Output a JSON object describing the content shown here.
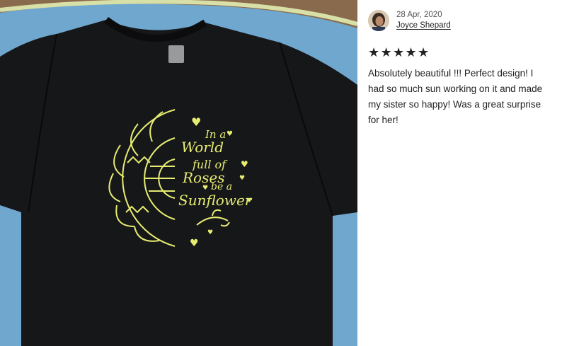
{
  "photo": {
    "print_text": [
      "In a",
      "World",
      "full of",
      "Roses",
      "be a",
      "Sunflower"
    ],
    "colors": {
      "shirt": "#161719",
      "print": "#e6ec70",
      "towel": "#6fa7cf",
      "floor": "#8a6a4c"
    }
  },
  "review": {
    "date": "28 Apr, 2020",
    "reviewer_name": "Joyce Shepard",
    "rating": 5,
    "stars": [
      "★",
      "★",
      "★",
      "★",
      "★"
    ],
    "text": "Absolutely beautiful !!! Perfect design! I had so much sun working on it and made my sister so happy! Was a great surprise for her!"
  }
}
